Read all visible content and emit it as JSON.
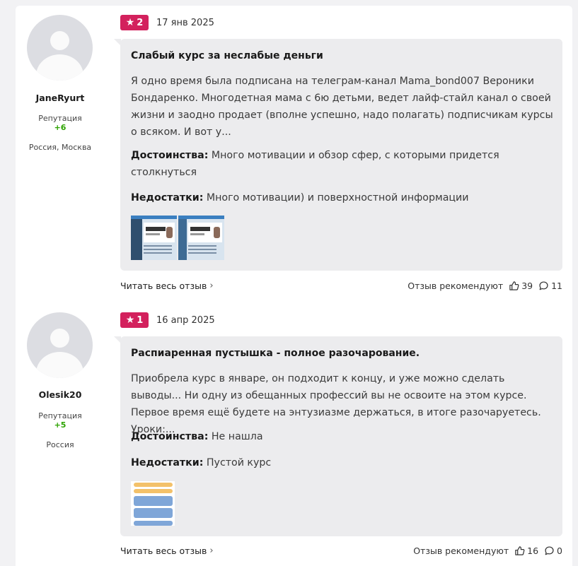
{
  "reviews": [
    {
      "user": {
        "name": "JaneRyurt",
        "reputation_label": "Репутация",
        "reputation_value": "+6",
        "location": "Россия, Москва"
      },
      "rating": "2",
      "date": "17 янв 2025",
      "title": "Слабый курс за неслабые деньги",
      "text": "Я одно время была подписана на телеграм-канал Mama_bond007 Вероники Бондаренко. Многодетная мама с 6ю детьми, ведет лайф-стайл канал о своей жизни и заодно продает (вполне успешно, надо полагать) подписчикам курсы о всяком. И вот у...",
      "pros_label": "Достоинства:",
      "pros": "Много мотивации и обзор сфер, с которыми придется столкнуться",
      "cons_label": "Недостатки:",
      "cons": "Много мотивации) и поверхностной информации",
      "read_more": "Читать весь отзыв",
      "recommend": "Отзыв рекомендуют",
      "likes": "39",
      "comments": "11"
    },
    {
      "user": {
        "name": "Olesik20",
        "reputation_label": "Репутация",
        "reputation_value": "+5",
        "location": "Россия"
      },
      "rating": "1",
      "date": "16 апр 2025",
      "title": "Распиаренная пустышка - полное разочарование.",
      "text": "Приобрела курс в январе, он подходит к концу, и уже можно сделать выводы... Ни одну из обещанных профессий вы не освоите на этом курсе. Первое время ещё будете на энтузиазме держаться, в итоге разочаруетесь. Уроки:...",
      "pros_label": "Достоинства:",
      "pros": "Не нашла",
      "cons_label": "Недостатки:",
      "cons": "Пустой курс",
      "read_more": "Читать весь отзыв",
      "recommend": "Отзыв рекомендуют",
      "likes": "16",
      "comments": "0"
    }
  ],
  "colors": {
    "badge": "#d3215d",
    "reputation": "#2ca300",
    "body_bg": "#ececee"
  },
  "icons": {
    "star": "star-icon",
    "chevron": "chevron-right-icon",
    "like": "thumbs-up-icon",
    "comment": "comment-icon"
  }
}
